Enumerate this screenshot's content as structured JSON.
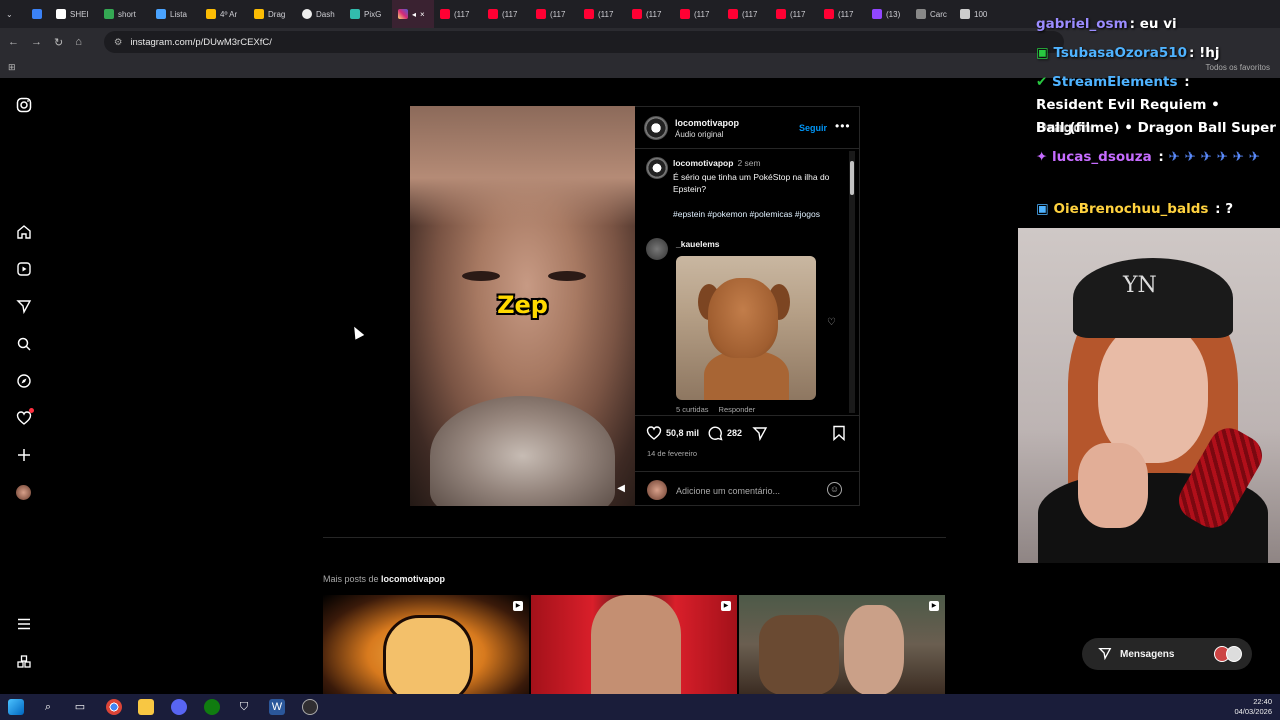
{
  "browser": {
    "tabs": [
      "SHEI",
      "short",
      "Lista",
      "4º Ar",
      "Drag",
      "Dash",
      "PixG",
      "(117",
      "(117",
      "(117",
      "(117",
      "(117",
      "(117",
      "(117",
      "(117",
      "(117",
      "(13)",
      "Carc",
      "100"
    ],
    "url": "instagram.com/p/DUwM3rCEXfC/",
    "all_favorites": "Todos os favoritos"
  },
  "post": {
    "username": "locomotivapop",
    "audio": "Áudio original",
    "follow_label": "Seguir",
    "video_caption": "Zep",
    "caption_user": "locomotivapop",
    "caption_time": "2 sem",
    "caption_text": "É sério que tinha um PokéStop na ilha do Epstein?",
    "hashtags": "#epstein #pokemon #polemicas #jogos",
    "comment_user": "_kauelems",
    "comment_likes": "5 curtidas",
    "reply_label": "Responder",
    "likes_count": "50,8 mil",
    "comments_count": "282",
    "date": "14 de fevereiro",
    "add_comment_placeholder": "Adicione um comentário..."
  },
  "more_posts": {
    "prefix": "Mais posts de",
    "user": "locomotivapop"
  },
  "messages_label": "Mensagens",
  "chat": {
    "lines": [
      {
        "name": "gabriel_osm",
        "text": ": eu vi",
        "color": "#9b8cff"
      },
      {
        "name": "TsubasaOzora510",
        "text": ": !hj",
        "color": "#4fb3ff"
      },
      {
        "name": "StreamElements",
        "text": " :",
        "color": "#4fb3ff"
      },
      {
        "name": "",
        "text": "Resident Evil Requiem • Dragon",
        "color": "#ffffff"
      },
      {
        "name": "",
        "text": "Ball (filme) • Dragon Ball Super",
        "color": "#ffffff"
      },
      {
        "name": "lucas_dsouza",
        "text": " :",
        "color": "#c66cff"
      },
      {
        "name": "OieBrenochuu_balds",
        "text": " : ?",
        "color": "#ffd23f"
      }
    ]
  },
  "taskbar": {
    "time": "22:40",
    "date": "04/03/2026"
  },
  "colors": {
    "follow_blue": "#0095f6",
    "caption_yellow": "#ffd900",
    "notification_red": "#ff3040"
  }
}
